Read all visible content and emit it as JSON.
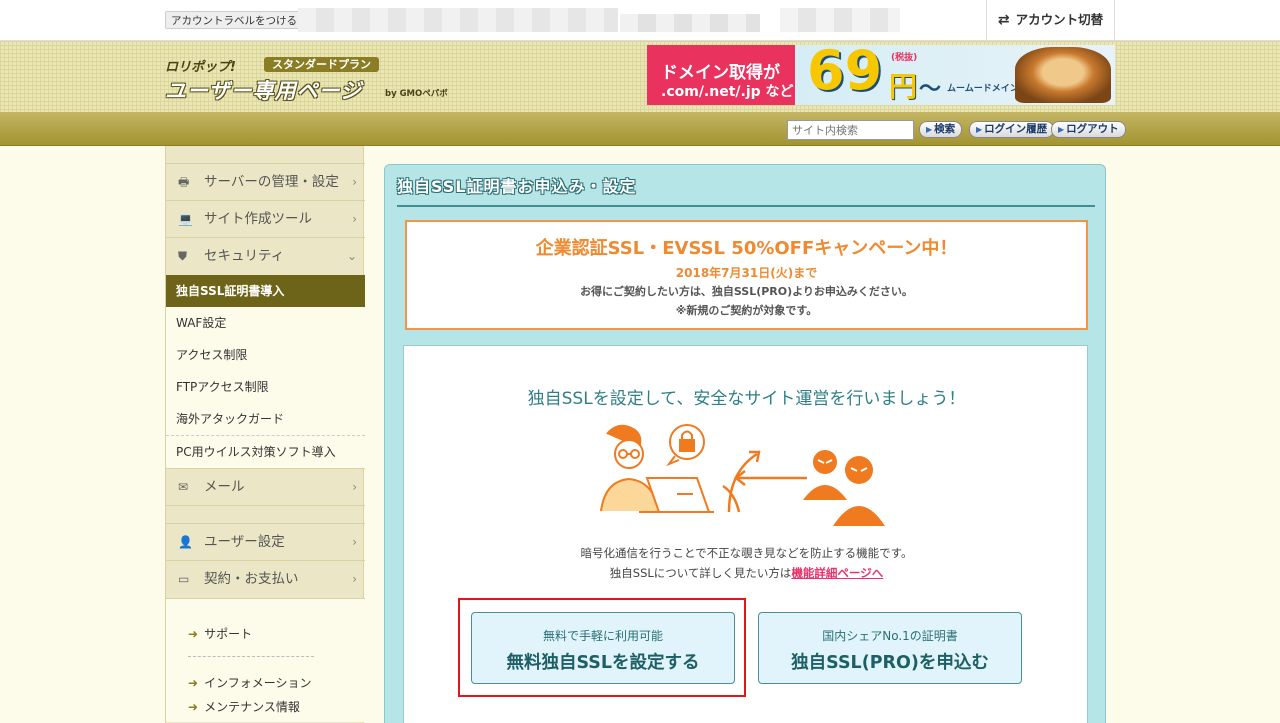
{
  "topbar": {
    "label_button": "アカウントラベルをつける",
    "account_switch": "アカウント切替",
    "switch_icon": "⇄"
  },
  "header": {
    "logo_top": "ロリポップ!",
    "logo_plan": "スタンダードプラン",
    "logo_main": "ユーザー専用ページ",
    "logo_by": "by GMOペパボ",
    "banner": {
      "line1": "ドメイン取得が",
      "line2": ".com/.net/.jp など",
      "price": "69",
      "tax": "(税抜)",
      "yen": "円",
      "tilde": "〜",
      "brand": "ムームードメイン"
    }
  },
  "nav": {
    "search_placeholder": "サイト内検索",
    "search_button": "検索",
    "login_history": "ログイン履歴",
    "logout": "ログアウト"
  },
  "sidebar": {
    "cat_server": "サーバーの管理・設定",
    "cat_site_tools": "サイト作成ツール",
    "cat_security": "セキュリティ",
    "sub_ssl": "独自SSL証明書導入",
    "sub_waf": "WAF設定",
    "sub_access": "アクセス制限",
    "sub_ftp": "FTPアクセス制限",
    "sub_attack": "海外アタックガード",
    "sub_virus": "PC用ウイルス対策ソフト導入",
    "cat_mail": "メール",
    "cat_user": "ユーザー設定",
    "cat_billing": "契約・お支払い",
    "support": "サポート",
    "information": "インフォメーション",
    "maintenance": "メンテナンス情報",
    "chevron": "›",
    "chevron_down": "⌄",
    "icon_server": "🖶",
    "icon_site": "💻",
    "icon_security": "⛊",
    "icon_mail": "✉",
    "icon_user": "👤",
    "icon_billing": "▭"
  },
  "main": {
    "title": "独自SSL証明書お申込み・設定",
    "campaign": {
      "title": "企業認証SSL・EVSSL 50%OFFキャンペーン中！",
      "date": "2018年7月31日(火)まで",
      "desc": "お得にご契約したい方は、独自SSL(PRO)よりお申込みください。",
      "note": "※新規のご契約が対象です。"
    },
    "intro": {
      "headline": "独自SSLを設定して、安全なサイト運営を行いましょう！",
      "desc": "暗号化通信を行うことで不正な覗き見などを防止する機能です。",
      "more_prefix": "独自SSLについて詳しく見たい方は",
      "more_link": "機能詳細ページへ"
    },
    "cta_free": {
      "sub": "無料で手軽に利用可能",
      "label": "無料独自SSLを設定する"
    },
    "cta_pro": {
      "sub": "国内シェアNo.1の証明書",
      "label": "独自SSL(PRO)を申込む"
    }
  },
  "colors": {
    "accent_orange": "#f08a30",
    "teal": "#2e7f86",
    "olive": "#6e6419",
    "highlight_red": "#e1161c",
    "link_pink": "#e8326a"
  }
}
